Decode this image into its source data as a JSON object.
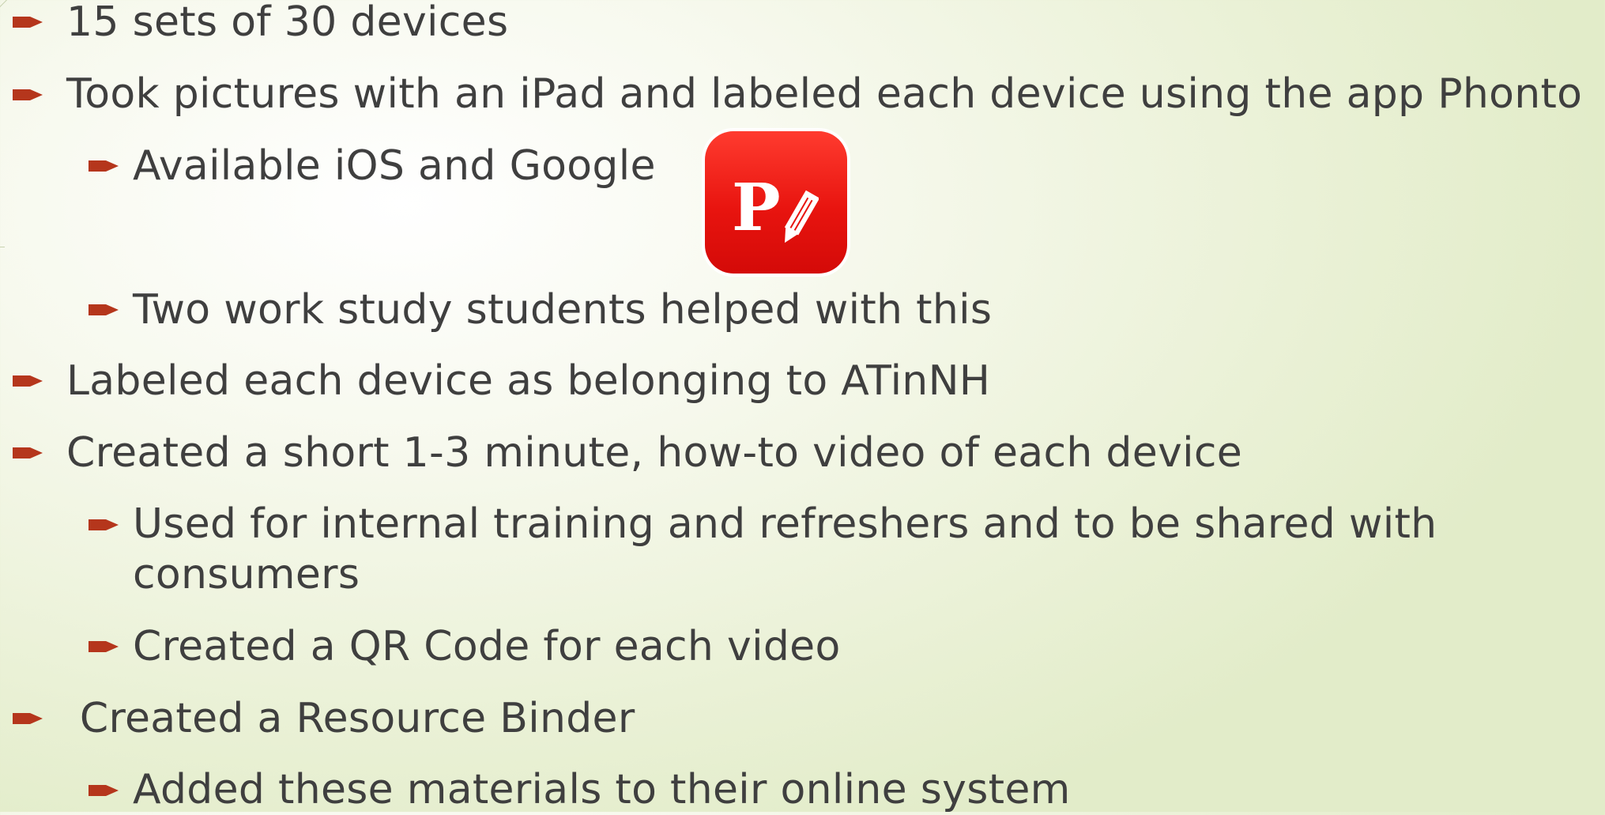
{
  "bullets": [
    {
      "id": "b1",
      "level": 1,
      "text": "15 sets of 30 devices"
    },
    {
      "id": "b2",
      "level": 1,
      "text": "Took pictures with an iPad and labeled each device using the app Phonto"
    },
    {
      "id": "b3",
      "level": 2,
      "text": "Available iOS and Google"
    },
    {
      "id": "b4",
      "level": 2,
      "text": "Two work study students helped with this"
    },
    {
      "id": "b5",
      "level": 1,
      "text": "Labeled each device as belonging to ATinNH"
    },
    {
      "id": "b6",
      "level": 1,
      "text": "Created a short 1-3 minute, how-to video of each device"
    },
    {
      "id": "b7",
      "level": 2,
      "text": "Used for internal training and refreshers and to be shared with consumers"
    },
    {
      "id": "b8",
      "level": 2,
      "text": "Created a QR Code for each video"
    },
    {
      "id": "b9",
      "level": 1,
      "text": " Created a Resource Binder"
    },
    {
      "id": "b10",
      "level": 2,
      "text": "Added these materials to their online system"
    }
  ],
  "app_icon": {
    "name": "phonto-app-icon",
    "letter": "P",
    "color": "#e8140f"
  },
  "colors": {
    "bullet": "#b5361c",
    "text": "#3f3f3f",
    "background": "#eaf1d6"
  }
}
